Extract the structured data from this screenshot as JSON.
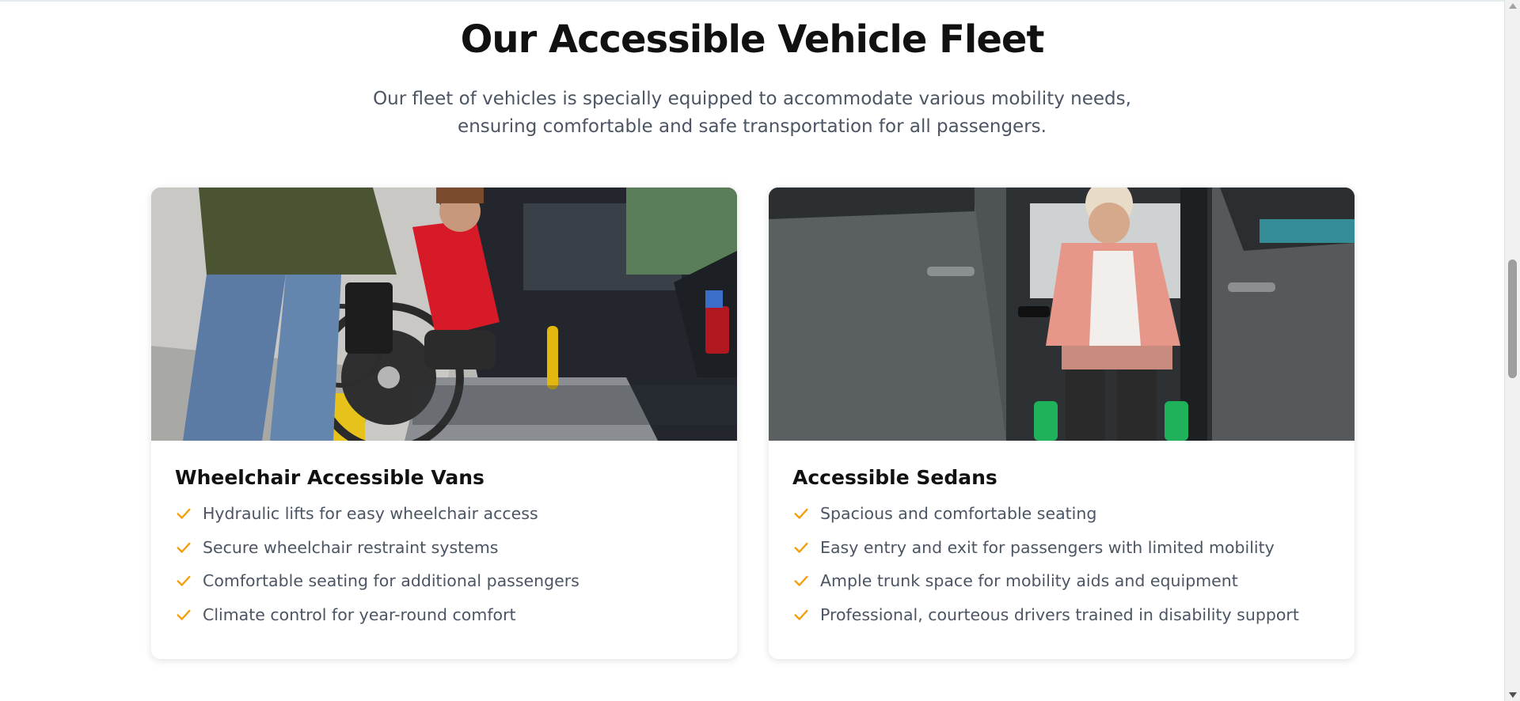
{
  "section": {
    "title": "Our Accessible Vehicle Fleet",
    "subtitle": "Our fleet of vehicles is specially equipped to accommodate various mobility needs, ensuring comfortable and safe transportation for all passengers."
  },
  "cards": [
    {
      "title": "Wheelchair Accessible Vans",
      "image_icon": "van-wheelchair-lift-photo",
      "features": [
        "Hydraulic lifts for easy wheelchair access",
        "Secure wheelchair restraint systems",
        "Comfortable seating for additional passengers",
        "Climate control for year-round comfort"
      ]
    },
    {
      "title": "Accessible Sedans",
      "image_icon": "sedan-passenger-photo",
      "features": [
        "Spacious and comfortable seating",
        "Easy entry and exit for passengers with limited mobility",
        "Ample trunk space for mobility aids and equipment",
        "Professional, courteous drivers trained in disability support"
      ]
    }
  ],
  "colors": {
    "accent_check": "#f59e0b",
    "heading": "#111111",
    "body_text": "#4b5563"
  }
}
